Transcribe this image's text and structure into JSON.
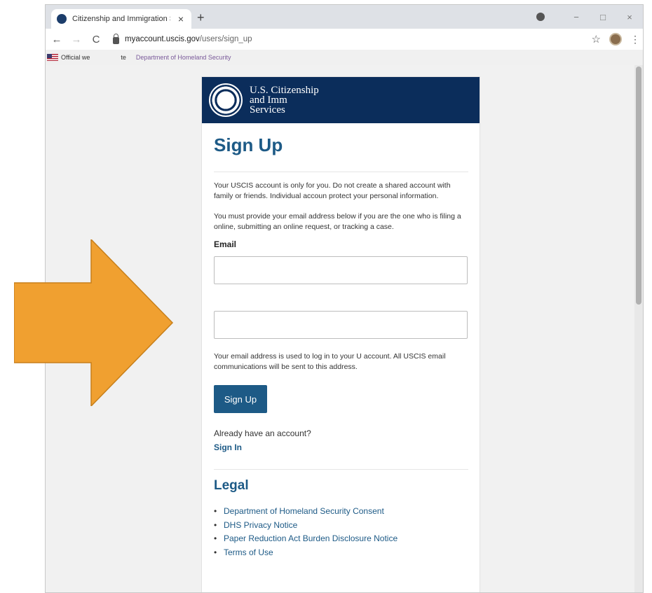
{
  "browser": {
    "tab_title": "Citizenship and Immigration Serv",
    "tab_close": "×",
    "new_tab": "+",
    "nav_back": "←",
    "nav_forward": "→",
    "nav_reload": "C",
    "url_host": "myaccount.uscis.gov",
    "url_path": "/users/sign_up",
    "win_min": "−",
    "win_max": "□",
    "win_close": "×",
    "star": "☆",
    "menu": "⋮"
  },
  "gov_banner": {
    "text_start": "Official we",
    "text_mid": "te",
    "text_end": "Department of Homeland Security"
  },
  "header": {
    "line1": "U.S. Citizenship",
    "line2": "and Imm",
    "line3": "Services"
  },
  "page": {
    "title": "Sign Up",
    "para1": "Your USCIS account is only for you. Do not create a shared account with family or friends. Individual accoun protect your personal information.",
    "para2": "You must provide your email address below if you are the one who is filing a online, submitting an online request, or tracking a case.",
    "email_label": "Email",
    "email_value": "",
    "confirm_value": "",
    "email_note": "Your email address is used to log in to your U account. All USCIS email communications will be sent to this address.",
    "signup_button": "Sign Up",
    "already_text": "Already have an account?",
    "signin_link": "Sign In",
    "legal_title": "Legal",
    "legal_items": [
      "Department of Homeland Security Consent",
      "DHS Privacy Notice",
      "Paper Reduction Act Burden Disclosure Notice",
      "Terms of Use"
    ]
  },
  "colors": {
    "header_navy": "#0b2d5b",
    "accent_blue": "#1d5a86",
    "arrow_orange": "#f0a030"
  },
  "icons": [
    "chrome-favicon",
    "lock-icon",
    "star-icon",
    "profile-avatar",
    "flag-icon",
    "dhs-seal-icon",
    "right-arrow-graphic"
  ]
}
